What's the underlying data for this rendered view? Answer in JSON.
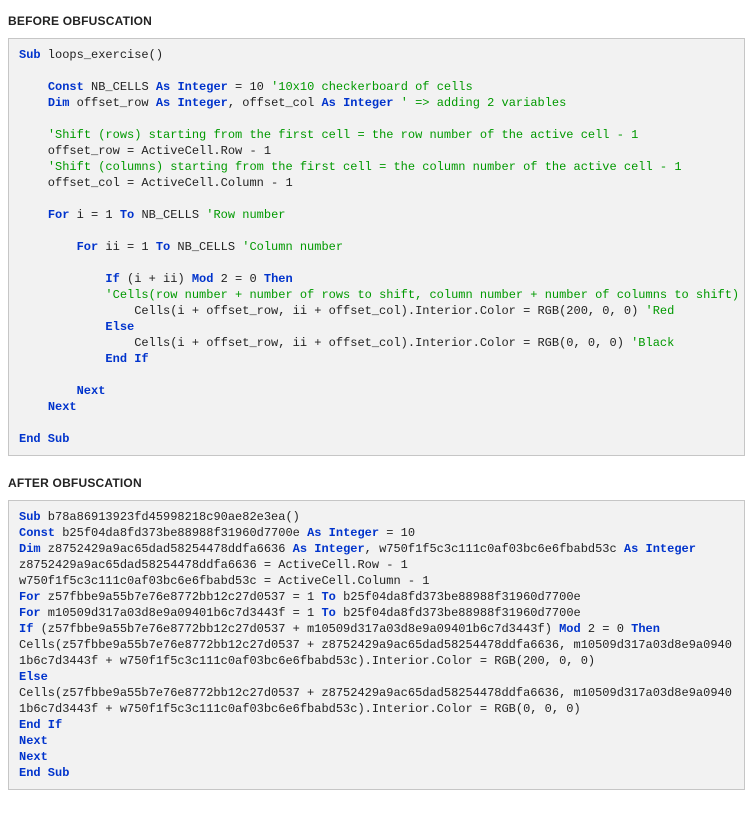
{
  "heading_before": "BEFORE OBFUSCATION",
  "heading_after": "AFTER OBFUSCATION",
  "before": {
    "l1_sub": "Sub",
    "l1_name": " loops_exercise()",
    "l3_const": "Const",
    "l3_name": " NB_CELLS ",
    "l3_as": "As",
    "l3_int": " Integer",
    "l3_eq": " = 10 ",
    "l3_cmt": "'10x10 checkerboard of cells",
    "l4_dim": "Dim",
    "l4_r": " offset_row ",
    "l4_as1": "As",
    "l4_int1": " Integer",
    "l4_mid": ", offset_col ",
    "l4_as2": "As",
    "l4_int2": " Integer",
    "l4_sp": " ",
    "l4_cmt": "' => adding 2 variables",
    "l6_cmt": "'Shift (rows) starting from the first cell = the row number of the active cell - 1",
    "l7": "    offset_row = ActiveCell.Row - 1",
    "l8_cmt": "'Shift (columns) starting from the first cell = the column number of the active cell - 1",
    "l9": "    offset_col = ActiveCell.Column - 1",
    "l11_for": "For",
    "l11_mid": " i = 1 ",
    "l11_to": "To",
    "l11_end": " NB_CELLS ",
    "l11_cmt": "'Row number",
    "l13_for": "For",
    "l13_mid": " ii = 1 ",
    "l13_to": "To",
    "l13_end": " NB_CELLS ",
    "l13_cmt": "'Column number",
    "l15_if": "If",
    "l15_cond": " (i + ii) ",
    "l15_mod": "Mod",
    "l15_rest": " 2 = 0 ",
    "l15_then": "Then",
    "l16_cmt": "'Cells(row number + number of rows to shift, column number + number of columns to shift)",
    "l17": "                Cells(i + offset_row, ii + offset_col).Interior.Color = RGB(200, 0, 0) ",
    "l17_cmt": "'Red",
    "l18_else": "Else",
    "l19": "                Cells(i + offset_row, ii + offset_col).Interior.Color = RGB(0, 0, 0) ",
    "l19_cmt": "'Black",
    "l20_endif": "End",
    "l20_if": " If",
    "l22_next": "Next",
    "l23_next": "Next",
    "l25_end": "End",
    "l25_sub": " Sub"
  },
  "after": {
    "l1_sub": "Sub",
    "l1_name": " b78a86913923fd45998218c90ae82e3ea()",
    "l2_const": "Const",
    "l2_name": " b25f04da8fd373be88988f31960d7700e ",
    "l2_as": "As",
    "l2_int": " Integer",
    "l2_eq": " = 10",
    "l3_dim": "Dim",
    "l3_a": " z8752429a9ac65dad58254478ddfa6636 ",
    "l3_as1": "As",
    "l3_int1": " Integer",
    "l3_mid": ", w750f1f5c3c111c0af03bc6e6fbabd53c ",
    "l3_as2": "As",
    "l3_int2": " Integer",
    "l4": "z8752429a9ac65dad58254478ddfa6636 = ActiveCell.Row - 1",
    "l5": "w750f1f5c3c111c0af03bc6e6fbabd53c = ActiveCell.Column - 1",
    "l6_for": "For",
    "l6_mid": " z57fbbe9a55b7e76e8772bb12c27d0537 = 1 ",
    "l6_to": "To",
    "l6_end": " b25f04da8fd373be88988f31960d7700e",
    "l7_for": "For",
    "l7_mid": " m10509d317a03d8e9a09401b6c7d3443f = 1 ",
    "l7_to": "To",
    "l7_end": " b25f04da8fd373be88988f31960d7700e",
    "l8_if": "If",
    "l8_cond": " (z57fbbe9a55b7e76e8772bb12c27d0537 + m10509d317a03d8e9a09401b6c7d3443f) ",
    "l8_mod": "Mod",
    "l8_rest": " 2 = 0 ",
    "l8_then": "Then",
    "l9": "Cells(z57fbbe9a55b7e76e8772bb12c27d0537 + z8752429a9ac65dad58254478ddfa6636, m10509d317a03d8e9a09401b6c7d3443f + w750f1f5c3c111c0af03bc6e6fbabd53c).Interior.Color = RGB(200, 0, 0)",
    "l10_else": "Else",
    "l11": "Cells(z57fbbe9a55b7e76e8772bb12c27d0537 + z8752429a9ac65dad58254478ddfa6636, m10509d317a03d8e9a09401b6c7d3443f + w750f1f5c3c111c0af03bc6e6fbabd53c).Interior.Color = RGB(0, 0, 0)",
    "l12_endif": "End",
    "l12_if": " If",
    "l13_next": "Next",
    "l14_next": "Next",
    "l15_end": "End",
    "l15_sub": " Sub"
  }
}
